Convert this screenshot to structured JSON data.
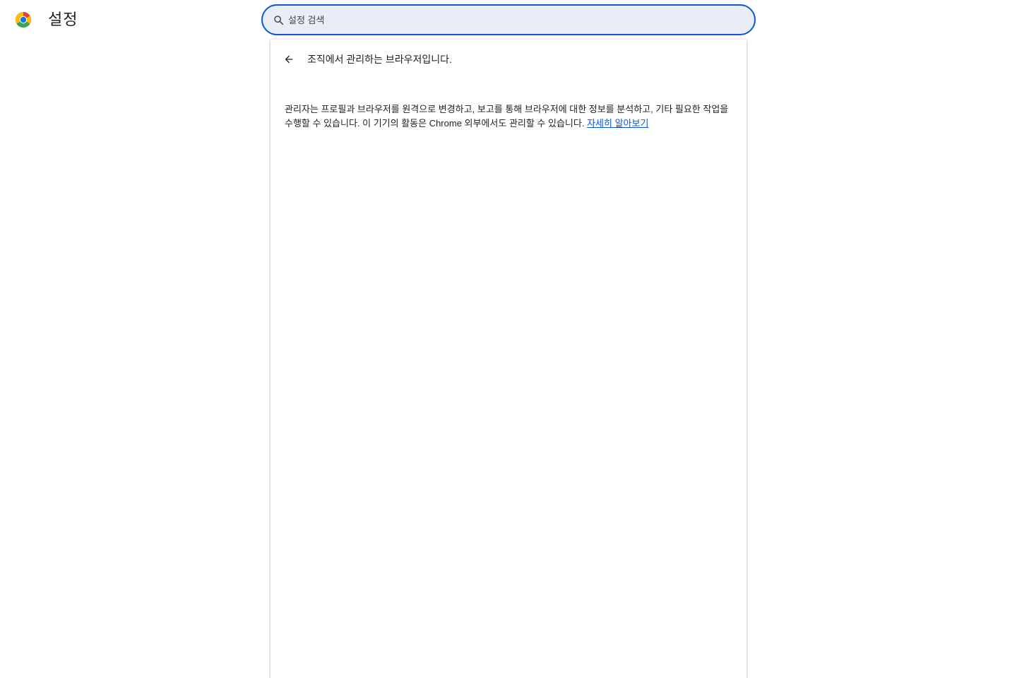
{
  "header": {
    "title": "설정"
  },
  "search": {
    "placeholder": "설정 검색",
    "value": ""
  },
  "managed_page": {
    "title": "조직에서 관리하는 브라우저입니다.",
    "description": "관리자는 프로필과 브라우저를 원격으로 변경하고, 보고를 통해 브라우저에 대한 정보를 분석하고, 기타 필요한 작업을 수행할 수 있습니다. 이 기기의 활동은 Chrome 외부에서도 관리할 수 있습니다.",
    "learn_more_label": "자세히 알아보기"
  },
  "colors": {
    "accent": "#0b57d0",
    "search_bg": "#e9eef6",
    "text": "#1f1f1f"
  },
  "icons": {
    "logo": "chrome-logo-icon",
    "search": "search-icon",
    "back": "arrow-back-icon"
  }
}
